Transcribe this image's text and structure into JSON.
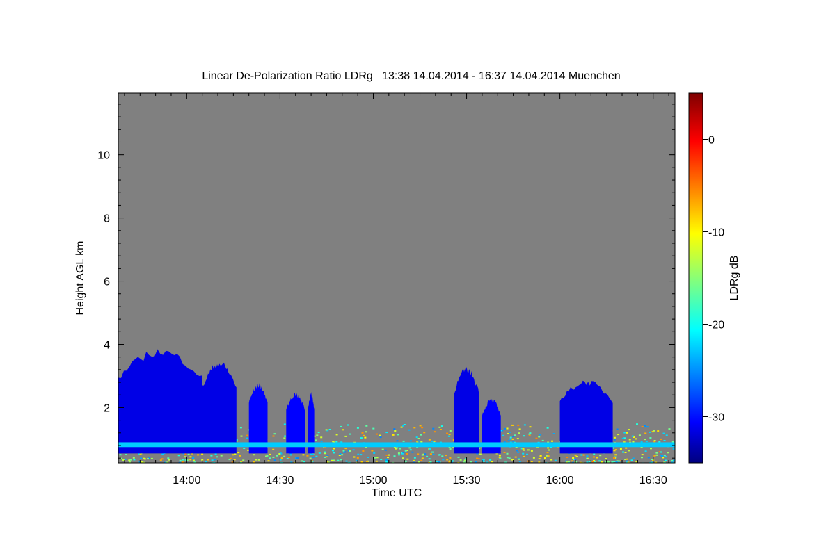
{
  "chart_data": {
    "type": "heatmap",
    "title": "Linear De-Polarization Ratio LDRg   13:38 14.04.2014 - 16:37 14.04.2014 Muenchen",
    "xlabel": "Time UTC",
    "ylabel": "Height AGL km",
    "colorbar_label": "LDRg dB",
    "x_range_minutes": [
      -22,
      157
    ],
    "y_range_km": [
      0.25,
      11.95
    ],
    "x_ticks": [
      {
        "minutes": 0,
        "label": "14:00"
      },
      {
        "minutes": 30,
        "label": "14:30"
      },
      {
        "minutes": 60,
        "label": "15:00"
      },
      {
        "minutes": 90,
        "label": "15:30"
      },
      {
        "minutes": 120,
        "label": "16:00"
      },
      {
        "minutes": 150,
        "label": "16:30"
      }
    ],
    "y_ticks": [
      2,
      4,
      6,
      8,
      10
    ],
    "colorbar_range": [
      -35,
      5
    ],
    "colorbar_ticks": [
      0,
      -10,
      -20,
      -30
    ],
    "colormap": "jet",
    "background_color": "#808080",
    "cloud_regions": [
      {
        "t_start": -22,
        "t_end": 5,
        "top_km": 3.9,
        "ldr_db": -31
      },
      {
        "t_start": 5,
        "t_end": 16,
        "top_km": 3.5,
        "ldr_db": -31
      },
      {
        "t_start": 20,
        "t_end": 26,
        "top_km": 2.8,
        "ldr_db": -30
      },
      {
        "t_start": 32,
        "t_end": 38,
        "top_km": 2.5,
        "ldr_db": -30
      },
      {
        "t_start": 39,
        "t_end": 41,
        "top_km": 2.5,
        "ldr_db": -30
      },
      {
        "t_start": 86,
        "t_end": 94,
        "top_km": 3.3,
        "ldr_db": -31
      },
      {
        "t_start": 95,
        "t_end": 101,
        "top_km": 2.3,
        "ldr_db": -30
      },
      {
        "t_start": 120,
        "t_end": 137,
        "top_km": 2.9,
        "ldr_db": -31
      }
    ],
    "boundary_layer": {
      "top_km": 1.5,
      "ldr_db_range": [
        -25,
        -5
      ]
    },
    "melting_layer_km": 0.8
  }
}
